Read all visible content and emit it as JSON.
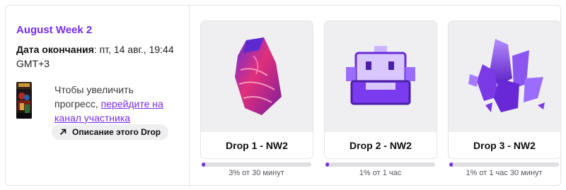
{
  "campaign": {
    "title": "August Week 2",
    "end_label": "Дата окончания",
    "end_value": "пт, 14 авг., 19:44 GMT+3",
    "progress_hint_text": "Чтобы увеличить прогресс, ",
    "progress_hint_link": "перейдите на канал участника",
    "description_button": "Описание этого Drop",
    "arrow_icon": "arrow-up-right-icon"
  },
  "drops": [
    {
      "name": "Drop 1 - NW2",
      "progress_label": "3% от 30 минут",
      "progress": 0.03,
      "icon": "red-crystal-icon"
    },
    {
      "name": "Drop 2 - NW2",
      "progress_label": "1% от 1 час",
      "progress": 0.01,
      "icon": "purple-robot-icon"
    },
    {
      "name": "Drop 3 - NW2",
      "progress_label": "1% от 1 час 30 минут",
      "progress": 0.01,
      "icon": "purple-crystal-cluster-icon"
    }
  ],
  "colors": {
    "accent": "#772ce8",
    "track": "#dedee3",
    "card_bg": "#efeff1"
  }
}
